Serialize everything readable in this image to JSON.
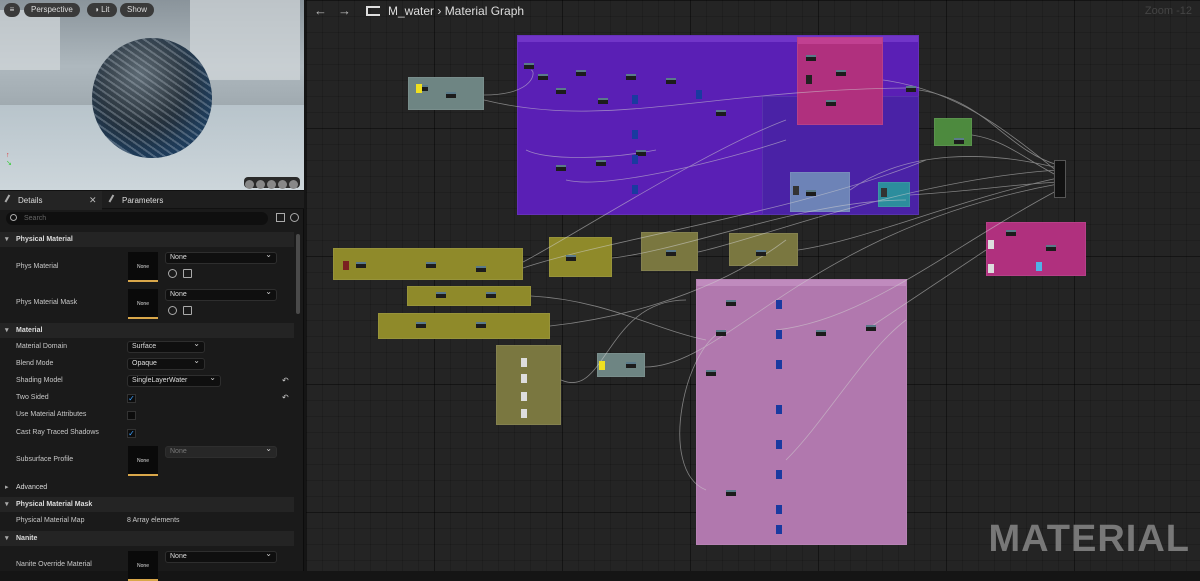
{
  "viewport": {
    "menu_icon": "hamburger-icon",
    "perspective_label": "Perspective",
    "lit_label": "Lit",
    "show_label": "Show"
  },
  "details": {
    "tab_details": "Details",
    "tab_parameters": "Parameters",
    "search_placeholder": "Search",
    "sections": {
      "physical_material": "Physical Material",
      "material": "Material",
      "advanced": "Advanced",
      "physical_material_mask": "Physical Material Mask",
      "nanite": "Nanite"
    },
    "phys_material": {
      "label": "Phys Material",
      "value": "None",
      "thumb": "None"
    },
    "phys_material_mask": {
      "label": "Phys Material Mask",
      "value": "None",
      "thumb": "None"
    },
    "material_domain": {
      "label": "Material Domain",
      "value": "Surface"
    },
    "blend_mode": {
      "label": "Blend Mode",
      "value": "Opaque"
    },
    "shading_model": {
      "label": "Shading Model",
      "value": "SingleLayerWater"
    },
    "two_sided": {
      "label": "Two Sided",
      "checked": true
    },
    "use_material_attributes": {
      "label": "Use Material Attributes",
      "checked": false
    },
    "cast_ray_traced_shadows": {
      "label": "Cast Ray Traced Shadows",
      "checked": true
    },
    "subsurface_profile": {
      "label": "Subsurface Profile",
      "value": "None",
      "thumb": "None"
    },
    "physical_material_map": {
      "label": "Physical Material Map",
      "value": "8 Array elements"
    },
    "nanite_override": {
      "label": "Nanite Override Material",
      "value": "None",
      "thumb": "None"
    }
  },
  "graph": {
    "asset_name": "M_water",
    "graph_name": "Material Graph",
    "zoom": "Zoom -12",
    "watermark": "MATERIAL"
  },
  "colors": {
    "comment_purple": "#5a1fb5",
    "comment_pink": "#b0307e",
    "comment_yellow": "#8f8a2a",
    "comment_mauve": "#b178ae",
    "comment_gray": "#6e8583",
    "comment_olive": "#7a7740",
    "comment_blue": "#6d83b7",
    "comment_teal": "#2c8d9d",
    "comment_green": "#4d8a3e"
  }
}
